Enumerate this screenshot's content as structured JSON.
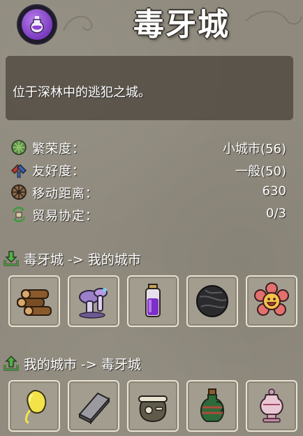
{
  "header": {
    "title": "毒牙城",
    "icon": "purple-potion-icon"
  },
  "description": "位于深林中的逃犯之城。",
  "stats": [
    {
      "label": "繁荣度：",
      "value": "小城市(56)",
      "icon": "prosperity-leaf-icon"
    },
    {
      "label": "友好度：",
      "value": "一般(50)",
      "icon": "friendship-handshake-icon"
    },
    {
      "label": "移动距离：",
      "value": "630",
      "icon": "distance-wheel-icon"
    },
    {
      "label": "贸易协定：",
      "value": "0/3",
      "icon": "trade-agreement-icon"
    }
  ],
  "imports": {
    "title": "毒牙城 -> 我的城市",
    "icon": "download-arrow-icon",
    "items": [
      {
        "icon": "wood-logs-icon"
      },
      {
        "icon": "mushroom-cluster-icon"
      },
      {
        "icon": "purple-vial-icon"
      },
      {
        "icon": "black-ball-icon"
      },
      {
        "icon": "smiling-flower-icon"
      }
    ]
  },
  "exports": {
    "title": "我的城市 -> 毒牙城",
    "icon": "upload-arrow-icon",
    "items": [
      {
        "icon": "yellow-slime-icon"
      },
      {
        "icon": "iron-ingot-icon"
      },
      {
        "icon": "bone-sack-icon"
      },
      {
        "icon": "wine-jug-icon"
      },
      {
        "icon": "ornate-vase-icon"
      }
    ]
  },
  "colors": {
    "background": "#8f8a7d",
    "panel": "#464038",
    "slot_border": "#e9e2d1",
    "accent_purple": "#7a3bbf",
    "arrow_green": "#3e9b3a"
  }
}
